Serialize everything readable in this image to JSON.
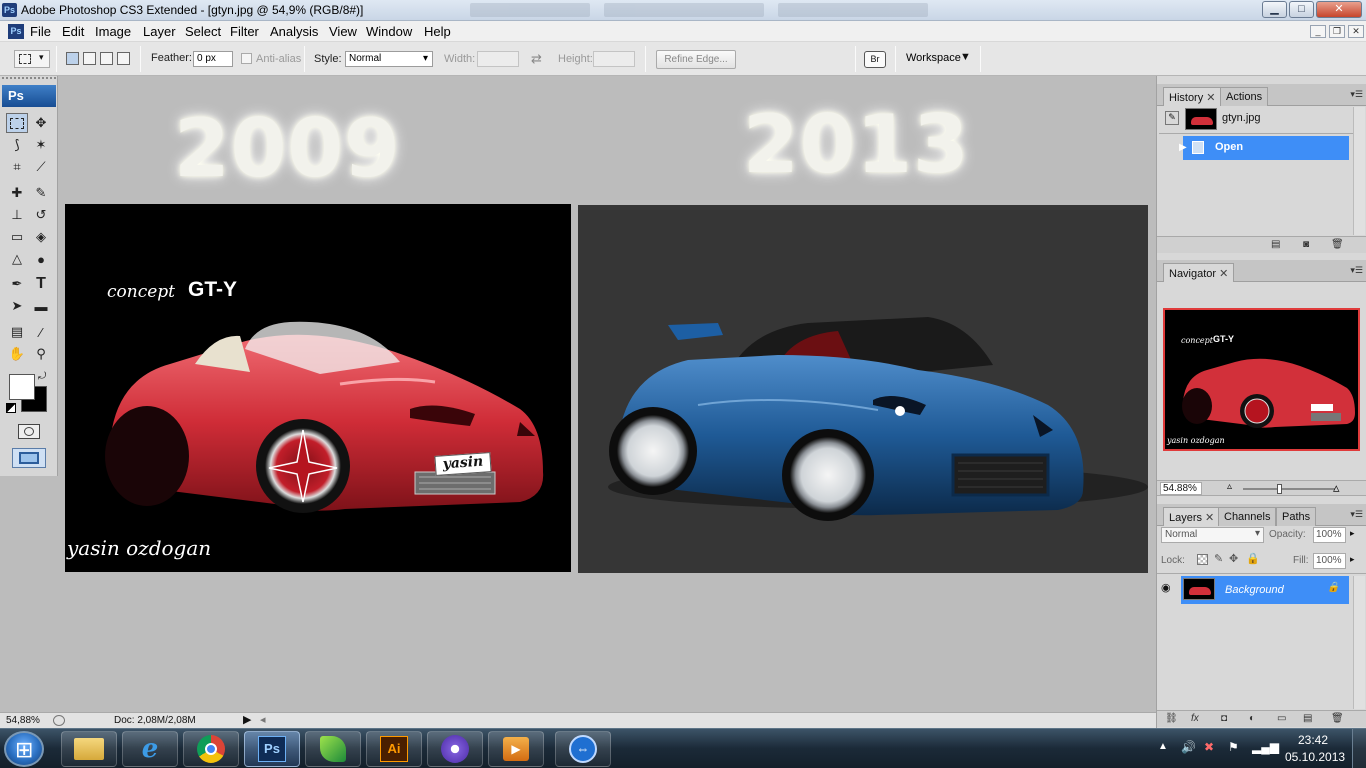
{
  "window": {
    "title": "Adobe Photoshop CS3 Extended - [gtyn.jpg @ 54,9% (RGB/8#)]",
    "ps_badge": "Ps"
  },
  "menu": [
    "File",
    "Edit",
    "Image",
    "Layer",
    "Select",
    "Filter",
    "Analysis",
    "View",
    "Window",
    "Help"
  ],
  "options": {
    "feather_label": "Feather:",
    "feather_value": "0 px",
    "anti_alias_label": "Anti-alias",
    "style_label": "Style:",
    "style_value": "Normal",
    "width_label": "Width:",
    "height_label": "Height:",
    "refine_edge": "Refine Edge...",
    "workspace": "Workspace"
  },
  "tools": {
    "logo": "Ps"
  },
  "canvas": {
    "year_left": "2009",
    "year_right": "2013",
    "caption_concept": "concept",
    "caption_model": "GT-Y",
    "plate_text": "yasin",
    "signature": "yasin ozdogan"
  },
  "history": {
    "tabs": [
      "History",
      "Actions"
    ],
    "snapshot_label": "gtyn.jpg",
    "step_label": "Open"
  },
  "navigator": {
    "tab": "Navigator",
    "zoom": "54.88%",
    "thumb_concept": "concept",
    "thumb_model": "GT-Y",
    "thumb_signature": "yasin ozdogan"
  },
  "layers": {
    "tabs": [
      "Layers",
      "Channels",
      "Paths"
    ],
    "blend_mode": "Normal",
    "opacity_label": "Opacity:",
    "opacity_value": "100%",
    "lock_label": "Lock:",
    "fill_label": "Fill:",
    "fill_value": "100%",
    "layer_name": "Background"
  },
  "status": {
    "zoom": "54,88%",
    "doc": "Doc: 2,08M/2,08M"
  },
  "taskbar": {
    "time": "23:42",
    "date": "05.10.2013",
    "apps": [
      "file-explorer",
      "internet-explorer",
      "chrome",
      "photoshop",
      "coreldraw",
      "illustrator",
      "bittorrent",
      "media-player",
      "teamviewer"
    ]
  },
  "colors": {
    "selection_blue": "#3e8ef7",
    "car_red": "#d2303a",
    "car_blue": "#1f5a96"
  }
}
